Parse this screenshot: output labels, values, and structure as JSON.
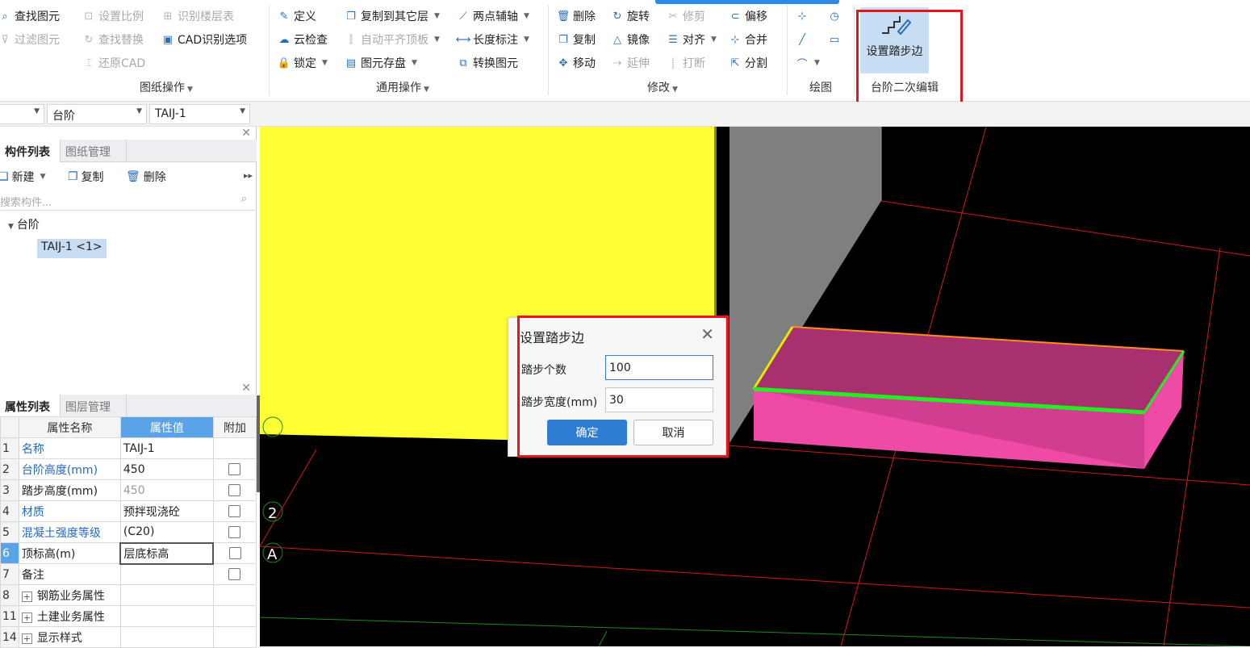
{
  "ribbon": {
    "drawing_ops": {
      "find_element": "查找图元",
      "filter_element": "过滤图元",
      "set_scale": "设置比例",
      "find_replace": "查找替换",
      "restore_cad": "还原CAD",
      "identify_floor_table": "识别楼层表",
      "cad_options": "CAD识别选项",
      "group_label": "图纸操作"
    },
    "general_ops": {
      "define": "定义",
      "cloud_check": "云检查",
      "lock": "锁定",
      "copy_to_layer": "复制到其它层",
      "auto_flush": "自动平齐顶板",
      "element_save": "图元存盘",
      "two_point_axis": "两点辅轴",
      "length_dim": "长度标注",
      "convert_element": "转换图元",
      "group_label": "通用操作"
    },
    "modify": {
      "delete": "删除",
      "copy": "复制",
      "move": "移动",
      "rotate": "旋转",
      "mirror": "镜像",
      "extend": "延伸",
      "trim": "修剪",
      "align": "对齐",
      "break": "打断",
      "offset": "偏移",
      "merge": "合并",
      "split": "分割",
      "group_label": "修改"
    },
    "draw": {
      "group_label": "绘图"
    },
    "step_edit": {
      "set_step_edge": "设置踏步边",
      "group_label": "台阶二次编辑"
    }
  },
  "selector_bar": {
    "category": "台阶",
    "component": "TAIJ-1"
  },
  "component_panel": {
    "tab_list": "构件列表",
    "tab_drawing": "图纸管理",
    "new_label": "新建",
    "copy_label": "复制",
    "delete_label": "删除",
    "search_placeholder": "搜索构件...",
    "tree_root": "台阶",
    "tree_child": "TAIJ-1 <1>"
  },
  "property_panel": {
    "tab_props": "属性列表",
    "tab_layers": "图层管理",
    "col_name": "属性名称",
    "col_value": "属性值",
    "col_extra": "附加",
    "rows": [
      {
        "num": "1",
        "name": "名称",
        "value": "TAIJ-1"
      },
      {
        "num": "2",
        "name": "台阶高度(mm)",
        "value": "450"
      },
      {
        "num": "3",
        "name": "踏步高度(mm)",
        "value": "450"
      },
      {
        "num": "4",
        "name": "材质",
        "value": "预拌现浇砼"
      },
      {
        "num": "5",
        "name": "混凝土强度等级",
        "value": "(C20)"
      },
      {
        "num": "6",
        "name": "顶标高(m)",
        "value": "层底标高"
      },
      {
        "num": "7",
        "name": "备注",
        "value": ""
      },
      {
        "num": "8",
        "name": "钢筋业务属性",
        "value": ""
      },
      {
        "num": "11",
        "name": "土建业务属性",
        "value": ""
      },
      {
        "num": "14",
        "name": "显示样式",
        "value": ""
      }
    ]
  },
  "viewport": {
    "axis_labels": [
      "2",
      "A"
    ]
  },
  "dialog": {
    "title": "设置踏步边",
    "step_count_label": "踏步个数",
    "step_count_value": "100",
    "step_width_label": "踏步宽度(mm)",
    "step_width_value": "30",
    "ok_label": "确定",
    "cancel_label": "取消"
  },
  "colors": {
    "accent": "#2d7dd2",
    "highlight_red": "#e8141c",
    "yellow_wall": "#ffff33",
    "step_pink": "#ee4aa6",
    "edge_green": "#22ee22"
  }
}
